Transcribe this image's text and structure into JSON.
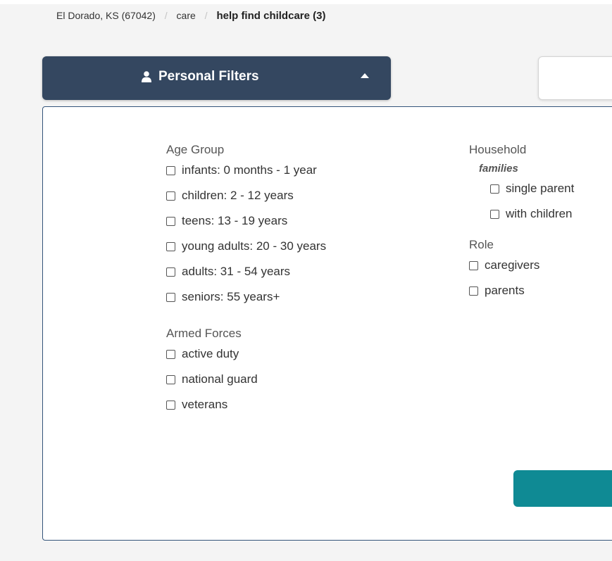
{
  "breadcrumb": {
    "location": "El Dorado, KS (67042)",
    "separator": "/",
    "category": "care",
    "current": "help find childcare (3)"
  },
  "filters_button": {
    "label": "Personal Filters",
    "icon": "user-icon",
    "caret": "caret-up-icon"
  },
  "age_group": {
    "title": "Age Group",
    "options": [
      "infants: 0 months - 1 year",
      "children: 2 - 12 years",
      "teens: 13 - 19 years",
      "young adults: 20 - 30 years",
      "adults: 31 - 54 years",
      "seniors: 55 years+"
    ]
  },
  "armed_forces": {
    "title": "Armed Forces",
    "options": [
      "active duty",
      "national guard",
      "veterans"
    ]
  },
  "household": {
    "title": "Household",
    "subgroup": "families",
    "options": [
      "single parent",
      "with children"
    ]
  },
  "role": {
    "title": "Role",
    "options": [
      "caregivers",
      "parents"
    ]
  },
  "colors": {
    "filters_button": "#344760",
    "panel_border": "#34547a",
    "apply_button": "#0f8a94"
  }
}
